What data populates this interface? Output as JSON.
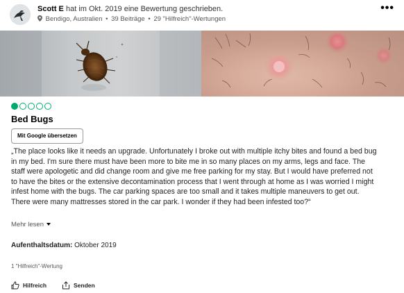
{
  "header": {
    "author": "Scott E",
    "action_text": "hat im Okt. 2019 eine Bewertung geschrieben.",
    "location": "Bendigo, Australien",
    "contributions": "39 Beiträge",
    "helpful_votes": "29 \"Hilfreich\"-Wertungen",
    "more_icon": "more-horizontal-icon"
  },
  "review": {
    "rating": 1,
    "rating_max": 5,
    "title": "Bed Bugs",
    "translate_label": "Mit Google übersetzen",
    "text": "„The place looks like it needs an upgrade. Unfortunately I broke out with multiple itchy bites and found a bed bug in my bed. I'm sure there must have been more to bite me in so many places on my arms, legs and face. The staff were apologetic and did change room and give me free parking for my stay. But I would have preferred not to have the bites or the extensive decontamination process that I went through at home as I was worried I might infest home with the bugs. The car parking spaces are too small and it takes multiple maneuvers to get out. There were many mattresses stored in the car park. I wonder if they had been infested too?“",
    "more_label": "Mehr lesen",
    "date_label": "Aufenthaltsdatum:",
    "date_value": "Oktober 2019",
    "helpful_count": "1 \"Hilfreich\"-Wertung"
  },
  "actions": {
    "helpful_label": "Hilfreich",
    "share_label": "Senden"
  },
  "colors": {
    "rating_green": "#00aa6c"
  }
}
